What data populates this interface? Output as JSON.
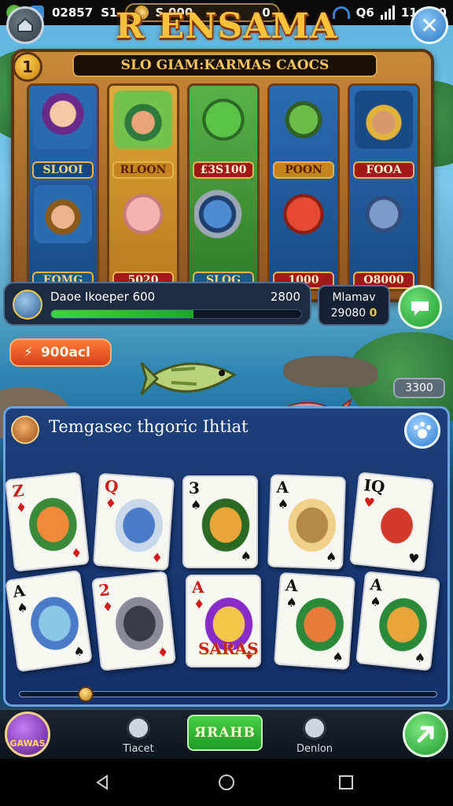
{
  "status_bar": {
    "left_text": "02857",
    "sim_text": "S1",
    "coins": "S.000",
    "coin_suffix": "0",
    "signal_text": "Q6",
    "time": "11:880"
  },
  "header": {
    "title": "R ENSAMA",
    "marquee": "SLO GIAM:KARMAS CAOCS",
    "level": "1"
  },
  "reels": [
    {
      "top_label": "SLOOI",
      "bottom_label": "EOMG"
    },
    {
      "top_label": "RLOON",
      "bottom_label": "5020"
    },
    {
      "top_label": "£3S100",
      "bottom_label": "SLOG"
    },
    {
      "top_label": "POON",
      "bottom_label": "1000"
    },
    {
      "top_label": "FOOA",
      "bottom_label": "O8000"
    }
  ],
  "progress": {
    "name": "Daoe Ikoeper 600",
    "score": "2800",
    "fraction": 0.57
  },
  "stat": {
    "label": "Mlamav",
    "value": "29080",
    "suffix": "0"
  },
  "bonus": {
    "label": "900acl"
  },
  "side_tag": "3300",
  "card_panel": {
    "title": "Temgasec thgoric Ihtiat",
    "cards_row1": [
      {
        "rank": "Z",
        "suit": "♦",
        "color": "red"
      },
      {
        "rank": "Q",
        "suit": "♦",
        "color": "red"
      },
      {
        "rank": "3",
        "suit": "♠",
        "color": "black"
      },
      {
        "rank": "A",
        "suit": "♠",
        "color": "black"
      },
      {
        "rank": "IQ",
        "suit": "♥",
        "color": "black"
      }
    ],
    "cards_row2": [
      {
        "rank": "A",
        "suit": "♠",
        "color": "black"
      },
      {
        "rank": "2",
        "suit": "♦",
        "color": "red"
      },
      {
        "rank": "A",
        "suit": "♦",
        "color": "red"
      },
      {
        "rank": "A",
        "suit": "♠",
        "color": "black"
      },
      {
        "rank": "A",
        "suit": "♠",
        "color": "black"
      }
    ],
    "card_caption": "SARAS",
    "slider_fraction": 0.16
  },
  "bottom_nav": {
    "avatar_label": "GAWAS",
    "item1": "Tiacet",
    "play_label": "ЯRAHB",
    "item2": "Denlon"
  },
  "colors": {
    "gold": "#f6c23a",
    "panel_blue": "#1d3f7a",
    "accent_green": "#1ea82a"
  }
}
